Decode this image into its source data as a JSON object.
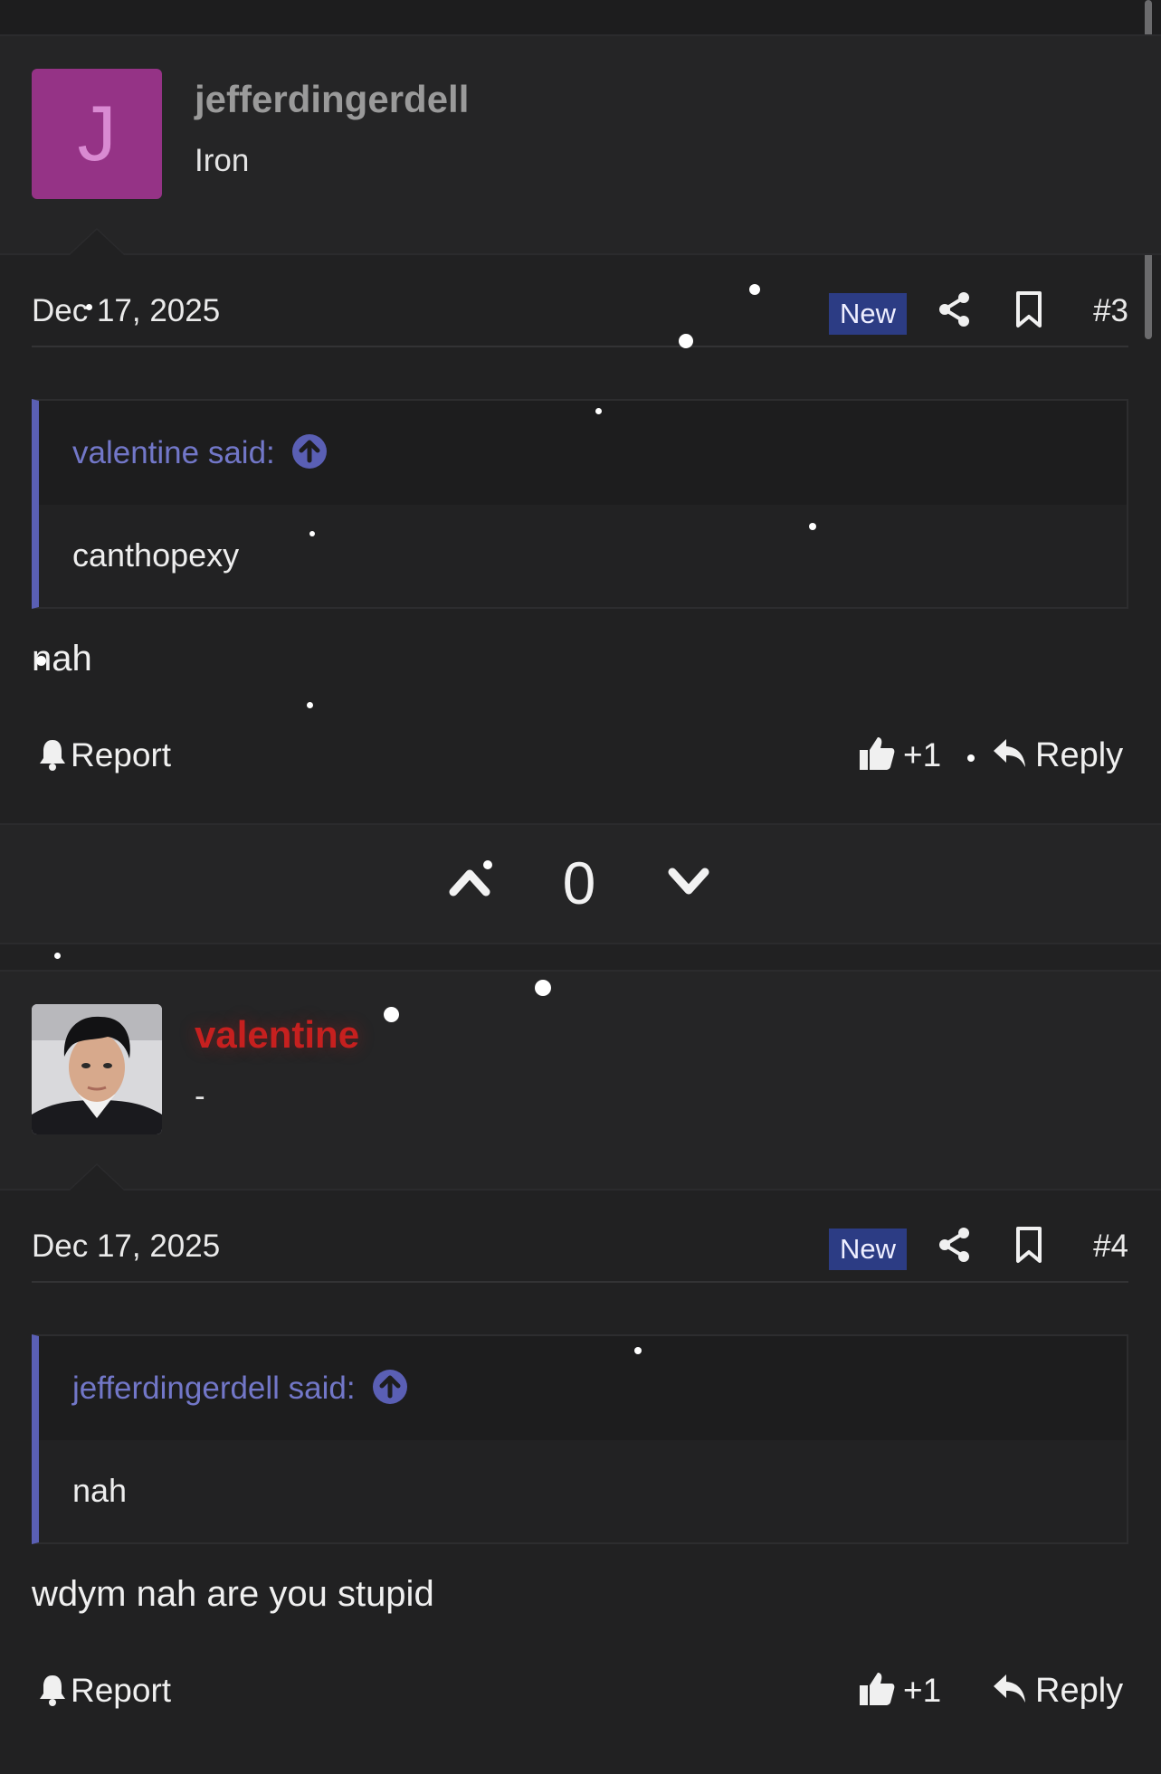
{
  "posts": [
    {
      "avatar_letter": "J",
      "username": "jefferdingerdell",
      "user_title": "Iron",
      "date": "Dec 17, 2025",
      "badge": "New",
      "post_number": "#3",
      "quote_author": "valentine said:",
      "quote_text": "canthopexy",
      "message": "nah",
      "report_label": "Report",
      "like_label": "+1",
      "reply_label": "Reply"
    },
    {
      "username": "valentine",
      "user_title": "-",
      "date": "Dec 17, 2025",
      "badge": "New",
      "post_number": "#4",
      "quote_author": "jefferdingerdell said:",
      "quote_text": "nah",
      "message": "wdym nah are you stupid",
      "report_label": "Report",
      "like_label": "+1",
      "reply_label": "Reply"
    }
  ],
  "vote": {
    "count": "0"
  },
  "colors": {
    "background": "#212122",
    "accent_quote": "#5a5fb4",
    "badge_new": "#2c3c84",
    "avatar_j": "#953386",
    "username_valentine": "#c6201f"
  },
  "icons": [
    "share-icon",
    "bookmark-icon",
    "arrow-up-circle-icon",
    "bell-icon",
    "thumbs-up-icon",
    "reply-arrow-icon",
    "chevron-up-icon",
    "chevron-down-icon"
  ]
}
